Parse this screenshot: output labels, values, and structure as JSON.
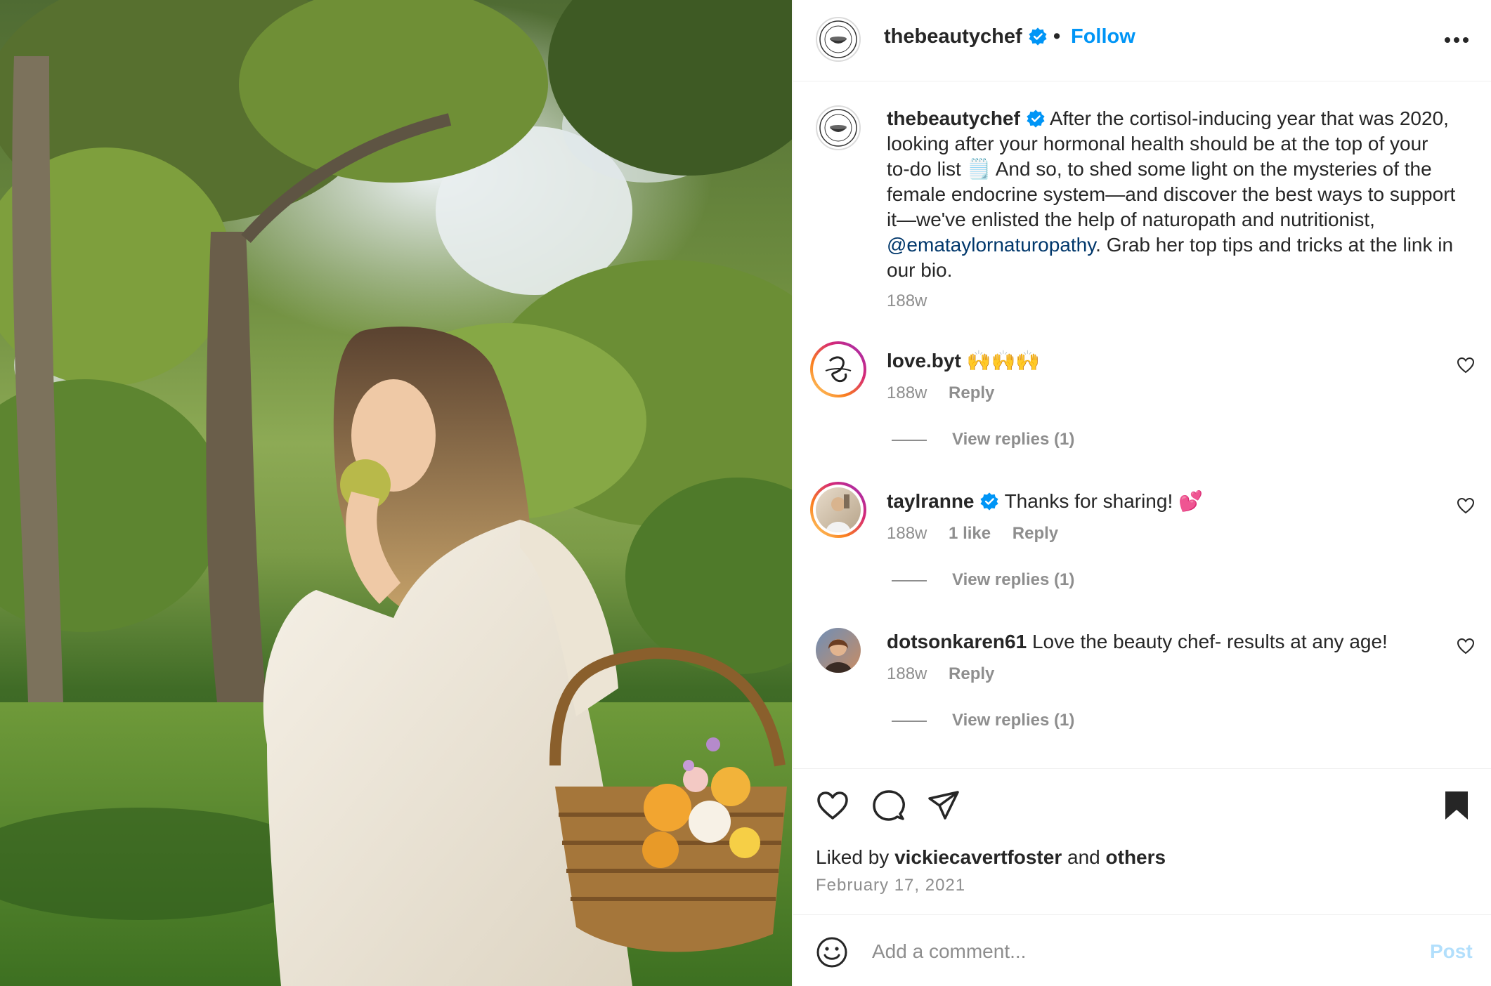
{
  "header": {
    "username": "thebeautychef",
    "separator": "•",
    "follow_label": "Follow",
    "more_icon": "more-horizontal-icon"
  },
  "caption": {
    "username": "thebeautychef",
    "text_part1": "After the cortisol-inducing year that was 2020, looking after your hormonal health should be at the top of your to-do list 🗒️ And so, to shed some light on the mysteries of the female endocrine system—and discover the best ways to support it—we've enlisted the help of naturopath and nutritionist, ",
    "mention": "@emataylornaturopathy",
    "text_part2": ". Grab her top tips and tricks at the link in our bio.",
    "time": "188w"
  },
  "comments": [
    {
      "username": "love.byt",
      "text": "🙌🙌🙌",
      "time": "188w",
      "likes": "",
      "reply_label": "Reply",
      "view_replies": "View replies (1)"
    },
    {
      "username": "taylranne",
      "text": "Thanks for sharing! 💕",
      "time": "188w",
      "likes": "1 like",
      "reply_label": "Reply",
      "view_replies": "View replies (1)"
    },
    {
      "username": "dotsonkaren61",
      "text": "Love the beauty chef- results at any age!",
      "time": "188w",
      "likes": "",
      "reply_label": "Reply",
      "view_replies": "View replies (1)"
    }
  ],
  "actions": {
    "liked_prefix": "Liked by",
    "liked_user": "vickiecavertfoster",
    "liked_and": "and",
    "liked_others": "others",
    "date": "February 17, 2021"
  },
  "add_comment": {
    "placeholder": "Add a comment...",
    "post_label": "Post"
  },
  "colors": {
    "accent": "#0095f6",
    "mention": "#00376b",
    "muted": "#8e8e8e",
    "post_disabled": "#b2dffc"
  }
}
